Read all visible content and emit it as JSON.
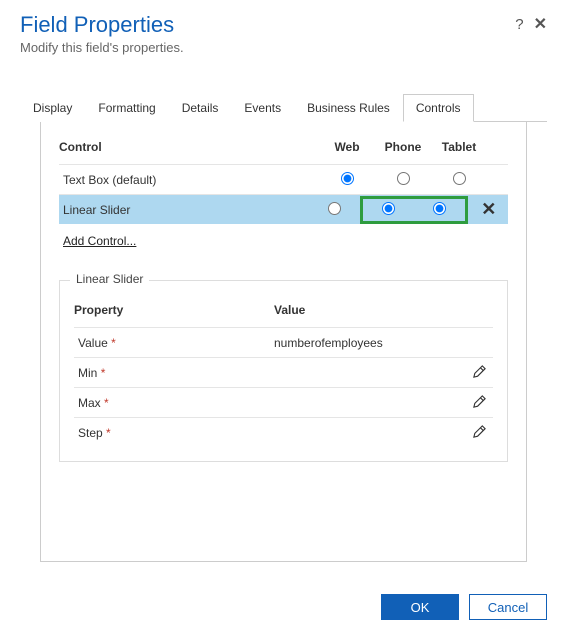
{
  "header": {
    "title": "Field Properties",
    "subtitle": "Modify this field's properties.",
    "help_icon": "?",
    "close_icon": "✕"
  },
  "tabs": [
    {
      "label": "Display",
      "active": false
    },
    {
      "label": "Formatting",
      "active": false
    },
    {
      "label": "Details",
      "active": false
    },
    {
      "label": "Events",
      "active": false
    },
    {
      "label": "Business Rules",
      "active": false
    },
    {
      "label": "Controls",
      "active": true
    }
  ],
  "controls_table": {
    "headers": {
      "control": "Control",
      "web": "Web",
      "phone": "Phone",
      "tablet": "Tablet"
    },
    "rows": [
      {
        "name": "Text Box (default)",
        "web": true,
        "phone": false,
        "tablet": false,
        "highlighted": false,
        "removable": false
      },
      {
        "name": "Linear Slider",
        "web": false,
        "phone": true,
        "tablet": true,
        "highlighted": true,
        "removable": true
      }
    ],
    "add_control_label": "Add Control...",
    "remove_icon": "✕"
  },
  "fieldset": {
    "legend": "Linear Slider",
    "headers": {
      "property": "Property",
      "value": "Value"
    },
    "rows": [
      {
        "name": "Value",
        "required": true,
        "value": "numberofemployees",
        "editable": false
      },
      {
        "name": "Min",
        "required": true,
        "value": "",
        "editable": true
      },
      {
        "name": "Max",
        "required": true,
        "value": "",
        "editable": true
      },
      {
        "name": "Step",
        "required": true,
        "value": "",
        "editable": true
      }
    ],
    "required_marker": "*"
  },
  "footer": {
    "ok_label": "OK",
    "cancel_label": "Cancel"
  }
}
